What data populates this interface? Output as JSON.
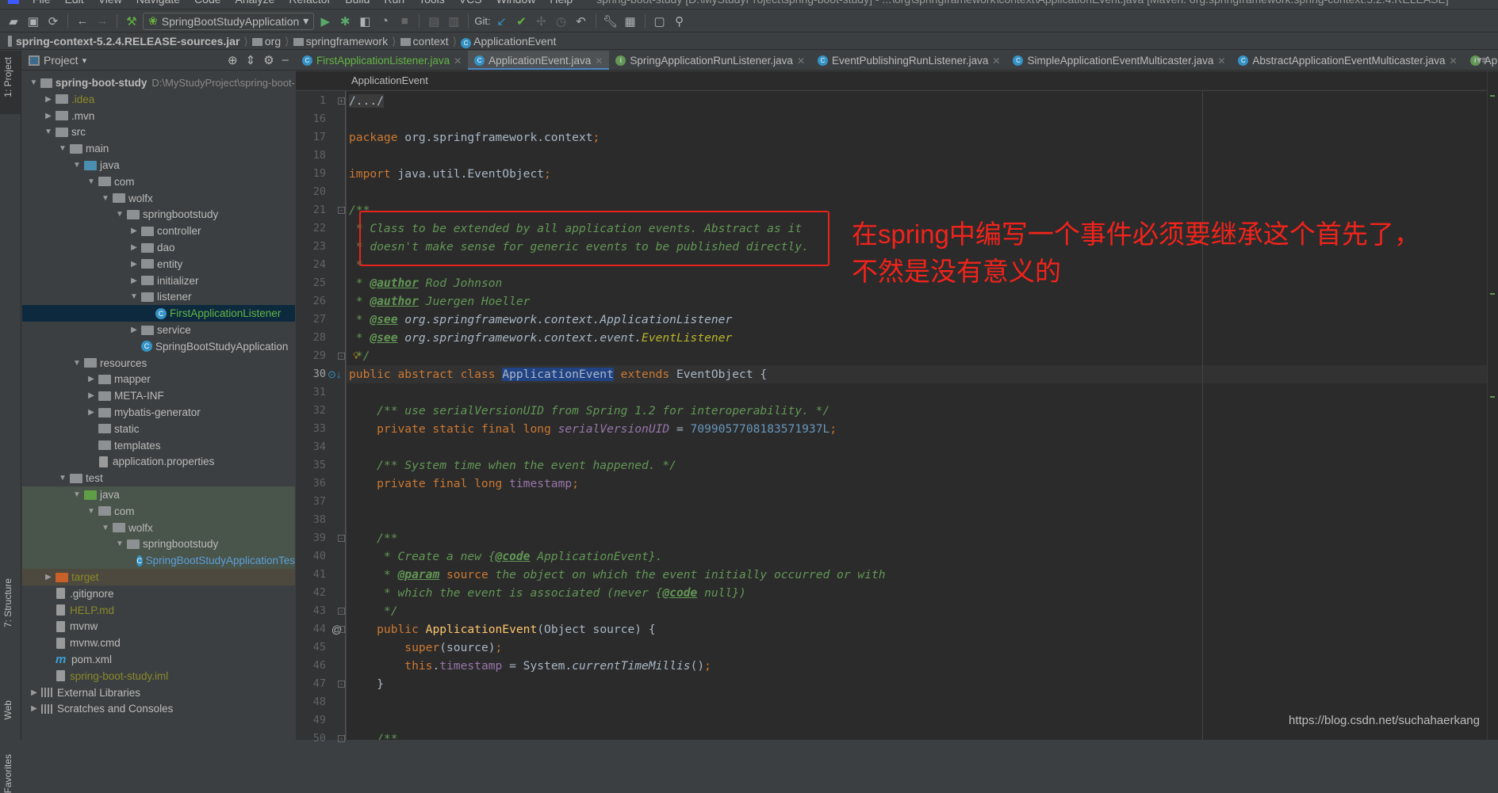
{
  "menubar": {
    "items": [
      "File",
      "Edit",
      "View",
      "Navigate",
      "Code",
      "Analyze",
      "Refactor",
      "Build",
      "Run",
      "Tools",
      "VCS",
      "Window",
      "Help"
    ],
    "title": "spring-boot-study [D:\\MyStudyProject\\spring-boot-study] - ...\\org\\springframework\\context\\ApplicationEvent.java [Maven: org.springframework:spring-context:5.2.4.RELEASE]"
  },
  "toolbar": {
    "run_config": "SpringBootStudyApplication",
    "git_label": "Git:"
  },
  "breadcrumb": [
    "spring-context-5.2.4.RELEASE-sources.jar",
    "org",
    "springframework",
    "context",
    "ApplicationEvent"
  ],
  "tool_strip": {
    "project": "1: Project",
    "structure": "7: Structure",
    "web": "Web",
    "favorites": "Favorites"
  },
  "project_panel": {
    "title": "Project"
  },
  "tree": [
    {
      "label": "spring-boot-study",
      "extra": "D:\\MyStudyProject\\spring-boot-",
      "depth": 0,
      "arrow": "open",
      "icon": "folder",
      "bold": true
    },
    {
      "label": ".idea",
      "depth": 1,
      "arrow": "closed",
      "icon": "folder",
      "color": "#8a8a2a"
    },
    {
      "label": ".mvn",
      "depth": 1,
      "arrow": "closed",
      "icon": "folder"
    },
    {
      "label": "src",
      "depth": 1,
      "arrow": "open",
      "icon": "folder"
    },
    {
      "label": "main",
      "depth": 2,
      "arrow": "open",
      "icon": "folder"
    },
    {
      "label": "java",
      "depth": 3,
      "arrow": "open",
      "icon": "src"
    },
    {
      "label": "com",
      "depth": 4,
      "arrow": "open",
      "icon": "folder"
    },
    {
      "label": "wolfx",
      "depth": 5,
      "arrow": "open",
      "icon": "folder"
    },
    {
      "label": "springbootstudy",
      "depth": 6,
      "arrow": "open",
      "icon": "folder"
    },
    {
      "label": "controller",
      "depth": 7,
      "arrow": "closed",
      "icon": "folder"
    },
    {
      "label": "dao",
      "depth": 7,
      "arrow": "closed",
      "icon": "folder"
    },
    {
      "label": "entity",
      "depth": 7,
      "arrow": "closed",
      "icon": "folder"
    },
    {
      "label": "initializer",
      "depth": 7,
      "arrow": "closed",
      "icon": "folder"
    },
    {
      "label": "listener",
      "depth": 7,
      "arrow": "open",
      "icon": "folder"
    },
    {
      "label": "FirstApplicationListener",
      "depth": 8,
      "arrow": "",
      "icon": "cls",
      "color": "#62b543",
      "bg": "#0d293e"
    },
    {
      "label": "service",
      "depth": 7,
      "arrow": "closed",
      "icon": "folder"
    },
    {
      "label": "SpringBootStudyApplication",
      "depth": 7,
      "arrow": "",
      "icon": "cls"
    },
    {
      "label": "resources",
      "depth": 3,
      "arrow": "open",
      "icon": "folder"
    },
    {
      "label": "mapper",
      "depth": 4,
      "arrow": "closed",
      "icon": "folder"
    },
    {
      "label": "META-INF",
      "depth": 4,
      "arrow": "closed",
      "icon": "folder"
    },
    {
      "label": "mybatis-generator",
      "depth": 4,
      "arrow": "closed",
      "icon": "folder"
    },
    {
      "label": "static",
      "depth": 4,
      "arrow": "",
      "icon": "folder"
    },
    {
      "label": "templates",
      "depth": 4,
      "arrow": "",
      "icon": "folder"
    },
    {
      "label": "application.properties",
      "depth": 4,
      "arrow": "",
      "icon": "file"
    },
    {
      "label": "test",
      "depth": 2,
      "arrow": "open",
      "icon": "folder"
    },
    {
      "label": "java",
      "depth": 3,
      "arrow": "open",
      "icon": "testsrc",
      "bg": "#49544a"
    },
    {
      "label": "com",
      "depth": 4,
      "arrow": "open",
      "icon": "folder",
      "bg": "#49544a"
    },
    {
      "label": "wolfx",
      "depth": 5,
      "arrow": "open",
      "icon": "folder",
      "bg": "#49544a"
    },
    {
      "label": "springbootstudy",
      "depth": 6,
      "arrow": "open",
      "icon": "folder",
      "bg": "#49544a"
    },
    {
      "label": "SpringBootStudyApplicationTes",
      "depth": 7,
      "arrow": "",
      "icon": "cls",
      "color": "#5c9fd8",
      "bg": "#49544a"
    },
    {
      "label": "target",
      "depth": 1,
      "arrow": "closed",
      "icon": "excl",
      "color": "#8a8a2a",
      "bg": "#4d493e"
    },
    {
      "label": ".gitignore",
      "depth": 1,
      "arrow": "",
      "icon": "file"
    },
    {
      "label": "HELP.md",
      "depth": 1,
      "arrow": "",
      "icon": "file",
      "color": "#8a8a2a"
    },
    {
      "label": "mvnw",
      "depth": 1,
      "arrow": "",
      "icon": "file"
    },
    {
      "label": "mvnw.cmd",
      "depth": 1,
      "arrow": "",
      "icon": "file"
    },
    {
      "label": "pom.xml",
      "depth": 1,
      "arrow": "",
      "icon": "m"
    },
    {
      "label": "spring-boot-study.iml",
      "depth": 1,
      "arrow": "",
      "icon": "file",
      "color": "#8a8a2a"
    },
    {
      "label": "External Libraries",
      "depth": 0,
      "arrow": "closed",
      "icon": "lib"
    },
    {
      "label": "Scratches and Consoles",
      "depth": 0,
      "arrow": "closed",
      "icon": "lib"
    }
  ],
  "tabs": [
    {
      "label": "FirstApplicationListener.java",
      "icon": "C",
      "color": "#62b543"
    },
    {
      "label": "ApplicationEvent.java",
      "icon": "C",
      "active": true
    },
    {
      "label": "SpringApplicationRunListener.java",
      "icon": "I"
    },
    {
      "label": "EventPublishingRunListener.java",
      "icon": "C"
    },
    {
      "label": "SimpleApplicationEventMulticaster.java",
      "icon": "C"
    },
    {
      "label": "AbstractApplicationEventMulticaster.java",
      "icon": "C"
    },
    {
      "label": "App",
      "icon": "I",
      "nox": true
    }
  ],
  "editor_breadcrumb": "ApplicationEvent",
  "code": [
    {
      "n": "1",
      "fold": "+",
      "toks": [
        [
          "fc",
          "/.../"
        ]
      ]
    },
    {
      "n": "16",
      "toks": []
    },
    {
      "n": "17",
      "toks": [
        [
          "k",
          "package "
        ],
        [
          "p",
          "org.springframework.context"
        ],
        [
          "k",
          ";"
        ]
      ]
    },
    {
      "n": "18",
      "toks": []
    },
    {
      "n": "19",
      "toks": [
        [
          "k",
          "import "
        ],
        [
          "p",
          "java.util.EventObject"
        ],
        [
          "k",
          ";"
        ]
      ]
    },
    {
      "n": "20",
      "toks": []
    },
    {
      "n": "21",
      "fold": "-",
      "toks": [
        [
          "c",
          "/**"
        ]
      ]
    },
    {
      "n": "22",
      "toks": [
        [
          "c",
          " * Class to be extended by all application events. Abstract as it"
        ]
      ]
    },
    {
      "n": "23",
      "toks": [
        [
          "c",
          " * doesn't make sense for generic events to be published directly."
        ]
      ]
    },
    {
      "n": "24",
      "toks": [
        [
          "c",
          " *"
        ]
      ]
    },
    {
      "n": "25",
      "toks": [
        [
          "c",
          " * "
        ],
        [
          "t",
          "@author"
        ],
        [
          "c",
          " Rod Johnson"
        ]
      ]
    },
    {
      "n": "26",
      "toks": [
        [
          "c",
          " * "
        ],
        [
          "t",
          "@author"
        ],
        [
          "c",
          " Juergen Hoeller"
        ]
      ]
    },
    {
      "n": "27",
      "toks": [
        [
          "c",
          " * "
        ],
        [
          "t",
          "@see"
        ],
        [
          "pi",
          " org.springframework.context.ApplicationListener"
        ]
      ]
    },
    {
      "n": "28",
      "toks": [
        [
          "c",
          " * "
        ],
        [
          "t",
          "@see"
        ],
        [
          "pi",
          " org.springframework.context.event."
        ],
        [
          "y",
          "EventListener"
        ]
      ]
    },
    {
      "n": "29",
      "fold": "-",
      "toks": [
        [
          "c",
          " */"
        ]
      ]
    },
    {
      "n": "30",
      "cur": true,
      "mark": "⊙↓",
      "toks": [
        [
          "k",
          "public abstract class "
        ],
        [
          "sel",
          "ApplicationEvent"
        ],
        [
          "k",
          " extends "
        ],
        [
          "p",
          "EventObject {"
        ]
      ]
    },
    {
      "n": "31",
      "toks": []
    },
    {
      "n": "32",
      "toks": [
        [
          "c",
          "    /** use serialVersionUID from Spring 1.2 for interoperability. */"
        ]
      ]
    },
    {
      "n": "33",
      "toks": [
        [
          "k",
          "    private static final long "
        ],
        [
          "fi",
          "serialVersionUID"
        ],
        [
          "p",
          " = "
        ],
        [
          "n",
          "7099057708183571937L"
        ],
        [
          "k",
          ";"
        ]
      ]
    },
    {
      "n": "34",
      "toks": []
    },
    {
      "n": "35",
      "toks": [
        [
          "c",
          "    /** System time when the event happened. */"
        ]
      ]
    },
    {
      "n": "36",
      "toks": [
        [
          "k",
          "    private final long "
        ],
        [
          "f",
          "timestamp"
        ],
        [
          "k",
          ";"
        ]
      ]
    },
    {
      "n": "37",
      "toks": []
    },
    {
      "n": "38",
      "toks": []
    },
    {
      "n": "39",
      "fold": "-",
      "toks": [
        [
          "c",
          "    /**"
        ]
      ]
    },
    {
      "n": "40",
      "toks": [
        [
          "c",
          "     * Create a new {"
        ],
        [
          "t",
          "@code"
        ],
        [
          "c",
          " ApplicationEvent}."
        ]
      ]
    },
    {
      "n": "41",
      "toks": [
        [
          "c",
          "     * "
        ],
        [
          "t",
          "@param"
        ],
        [
          "k",
          " source"
        ],
        [
          "c",
          " the object on which the event initially occurred or with"
        ]
      ]
    },
    {
      "n": "42",
      "toks": [
        [
          "c",
          "     * which the event is associated (never {"
        ],
        [
          "t",
          "@code"
        ],
        [
          "c",
          " null})"
        ]
      ]
    },
    {
      "n": "43",
      "fold": "-",
      "toks": [
        [
          "c",
          "     */"
        ]
      ]
    },
    {
      "n": "44",
      "fold": "-",
      "mark": "@",
      "toks": [
        [
          "k",
          "    public "
        ],
        [
          "m",
          "ApplicationEvent"
        ],
        [
          "p",
          "(Object source) {"
        ]
      ]
    },
    {
      "n": "45",
      "toks": [
        [
          "k",
          "        super"
        ],
        [
          "p",
          "(source)"
        ],
        [
          "k",
          ";"
        ]
      ]
    },
    {
      "n": "46",
      "toks": [
        [
          "k",
          "        this"
        ],
        [
          "p",
          "."
        ],
        [
          "f",
          "timestamp"
        ],
        [
          "p",
          " = System."
        ],
        [
          "pi",
          "currentTimeMillis"
        ],
        [
          "p",
          "()"
        ],
        [
          "k",
          ";"
        ]
      ]
    },
    {
      "n": "47",
      "fold": "-",
      "toks": [
        [
          "p",
          "    }"
        ]
      ]
    },
    {
      "n": "48",
      "toks": []
    },
    {
      "n": "49",
      "toks": []
    },
    {
      "n": "50",
      "fold": "-",
      "toks": [
        [
          "c",
          "    /**"
        ]
      ]
    }
  ],
  "annotation": {
    "line1": "在spring中编写一个事件必须要继承这个首先了，",
    "line2": "不然是没有意义的",
    "color": "#f2231b"
  },
  "watermark": "https://blog.csdn.net/suchahaerkang"
}
